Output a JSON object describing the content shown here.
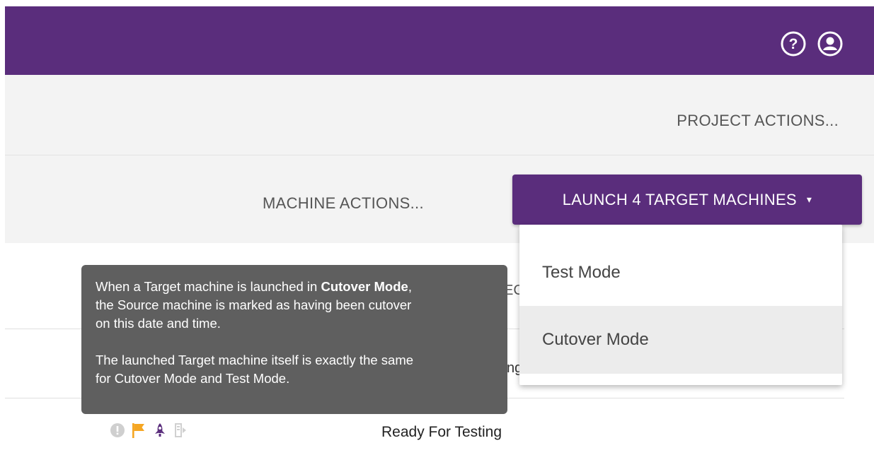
{
  "header": {
    "help_icon": "question-circle-icon",
    "user_icon": "user-circle-icon"
  },
  "project_actions": {
    "label": "PROJECT ACTIONS..."
  },
  "machine_actions": {
    "label": "MACHINE ACTIONS..."
  },
  "launch_button": {
    "label": "LAUNCH 4 TARGET MACHINES",
    "caret": "▾"
  },
  "launch_menu": {
    "items": [
      {
        "label": "Test Mode"
      },
      {
        "label": "Cutover Mode"
      }
    ]
  },
  "tooltip": {
    "line1_prefix": "When a Target machine is launched in ",
    "line1_bold": "Cutover Mode",
    "line1_suffix": ",",
    "line2": "the Source machine is marked as having been cutover",
    "line3": "on this date and time.",
    "line4": "The launched Target machine itself is exactly the same",
    "line5": "for Cutover Mode and Test Mode."
  },
  "table": {
    "header_peek": "EC",
    "row_peek": "ng",
    "row": {
      "status_icons": [
        "alert-circle-icon",
        "flag-icon",
        "rocket-icon",
        "cutover-icon"
      ],
      "status": "Ready For Testing"
    }
  },
  "colors": {
    "brand": "#5a2d7c",
    "flag": "#f5a623",
    "tooltip_bg": "#5f5f5f"
  }
}
